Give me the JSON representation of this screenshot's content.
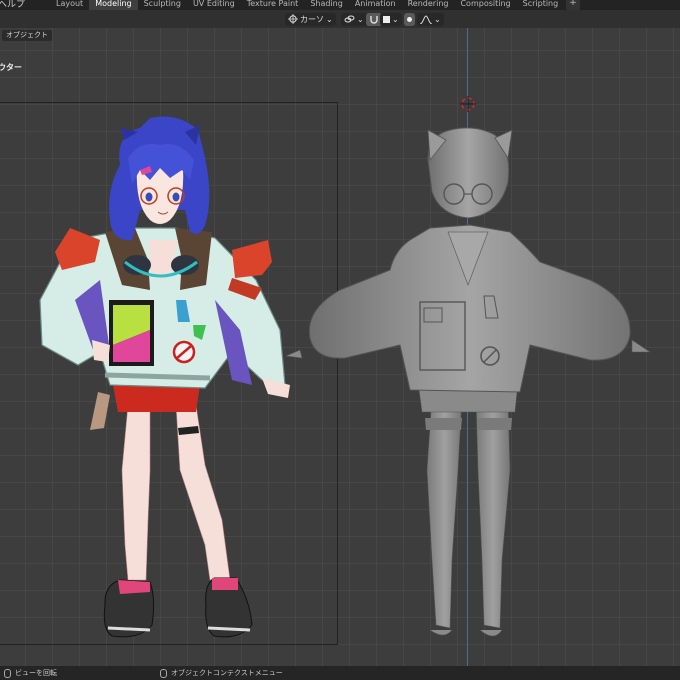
{
  "menu": {
    "help_label": "ヘルプ"
  },
  "workspace_tabs": [
    "Layout",
    "Modeling",
    "Sculpting",
    "UV Editing",
    "Texture Paint",
    "Shading",
    "Animation",
    "Rendering",
    "Compositing",
    "Scripting"
  ],
  "active_tab": "Modeling",
  "header": {
    "pivot_label": "カーソ",
    "pivot_icon": "transform-pivot-icon",
    "snap_icon": "link-icon",
    "proportional_icon": "magnet-icon",
    "shading_icon": "solid-square-icon",
    "falloff_icon": "falloff-curve-icon"
  },
  "viewport": {
    "object_mode_button": "オブジェクト",
    "outliner_label": "ウター"
  },
  "status": {
    "left_text": "ビューを回転",
    "right_text": "オブジェクトコンテクストメニュー"
  },
  "colors": {
    "grid_bg": "#3d3d3d",
    "accent_tab": "#3f3f3f",
    "hair": "#3a45c8",
    "jacket": "#d6ece6",
    "skirt": "#cc2a1e",
    "ribbon": "#d9442a",
    "model_gray": "#8e8e8e",
    "axis_blue": "#4c6a9a"
  }
}
